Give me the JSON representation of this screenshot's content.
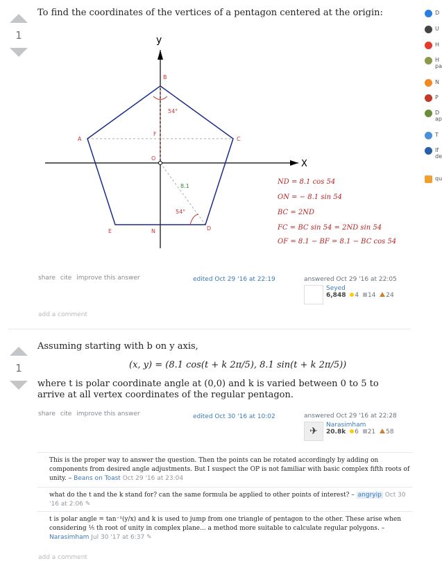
{
  "answer1": {
    "votes": "1",
    "text": "To find the coordinates of the vertices of a pentagon centered at the origin:",
    "figure": {
      "axis_y": "y",
      "axis_x": "X",
      "labels": {
        "B": "B",
        "A": "A",
        "C": "C",
        "F": "F",
        "O": "O",
        "E": "E",
        "N": "N",
        "D": "D"
      },
      "angle_top": "54°",
      "angle_bottom": "54°",
      "radius": "8.1",
      "formulas": [
        "ND = 8.1 cos 54",
        "ON = − 8.1 sin 54",
        "BC = 2ND",
        "FC = BC sin 54 = 2ND sin 54",
        "OF = 8.1 − BF = 8.1 − BC cos 54"
      ]
    },
    "menu": [
      "share",
      "cite",
      "improve this answer"
    ],
    "edited": "edited Oct 29 '16 at 22:19",
    "answered": "answered Oct 29 '16 at 22:05",
    "user": "Seyed",
    "rep": "6,848",
    "gold": "4",
    "silver": "14",
    "bronze": "24",
    "add_comment": "add a comment"
  },
  "answer2": {
    "votes": "1",
    "text1": "Assuming starting with b on y axis,",
    "equation": "(x, y) = (8.1 cos(t + k 2π/5), 8.1 sin(t + k 2π/5))",
    "text2": "where t is polar coordinate angle at (0,0) and k is varied between 0 to 5 to arrive at all vertex coordinates of the regular pentagon.",
    "menu": [
      "share",
      "cite",
      "improve this answer"
    ],
    "edited": "edited Oct 30 '16 at 10:02",
    "answered": "answered Oct 29 '16 at 22:28",
    "user": "Narasimham",
    "rep": "20.8k",
    "gold": "6",
    "silver": "21",
    "bronze": "58",
    "comments": [
      {
        "text": "This is the proper way to answer the question. Then the points can be rotated accordingly by adding on components from desired angle adjustments. But I suspect the OP is not familiar with basic complex fifth roots of unity. –",
        "user": "Beans on Toast",
        "date": "Oct 29 '16 at 23:04"
      },
      {
        "text": "what do the t and the k stand for? can the same formula be applied to other points of interest? –",
        "user": "angryip",
        "date": "Oct 30 '16 at 2:06"
      },
      {
        "text": "t is polar angle = tan⁻¹(y/x) and k is used to jump from one triangle of pentagon to the other. These arise when considering ⅕ th root of unity in complex plane... a method more suitable to calculate regular polygons. –",
        "user": "Narasimham",
        "date": "Jul 30 '17 at 6:37"
      }
    ],
    "add_comment": "add a comment"
  },
  "sidebar": {
    "items": [
      {
        "text": "D",
        "color": "#2b7de0"
      },
      {
        "text": "U",
        "color": "#444444"
      },
      {
        "text": "H",
        "color": "#e23b2e"
      },
      {
        "text": "H pa",
        "color": "#8b9a4a"
      },
      {
        "text": "N",
        "color": "#f08a24"
      },
      {
        "text": "P",
        "color": "#c0392b"
      },
      {
        "text": "D ap",
        "color": "#6a8f3a"
      },
      {
        "text": "T",
        "color": "#4a90d9"
      },
      {
        "text": "If de",
        "color": "#2b5fa8"
      },
      {
        "text": "qu",
        "color": "#f0a030"
      }
    ]
  },
  "colors": {
    "link": "#3b7ab9",
    "gold": "#ffcc01",
    "silver": "#b4b8bc",
    "bronze": "#d1a684",
    "formula": "#b22222",
    "pentagon": "#1a2a8a"
  }
}
